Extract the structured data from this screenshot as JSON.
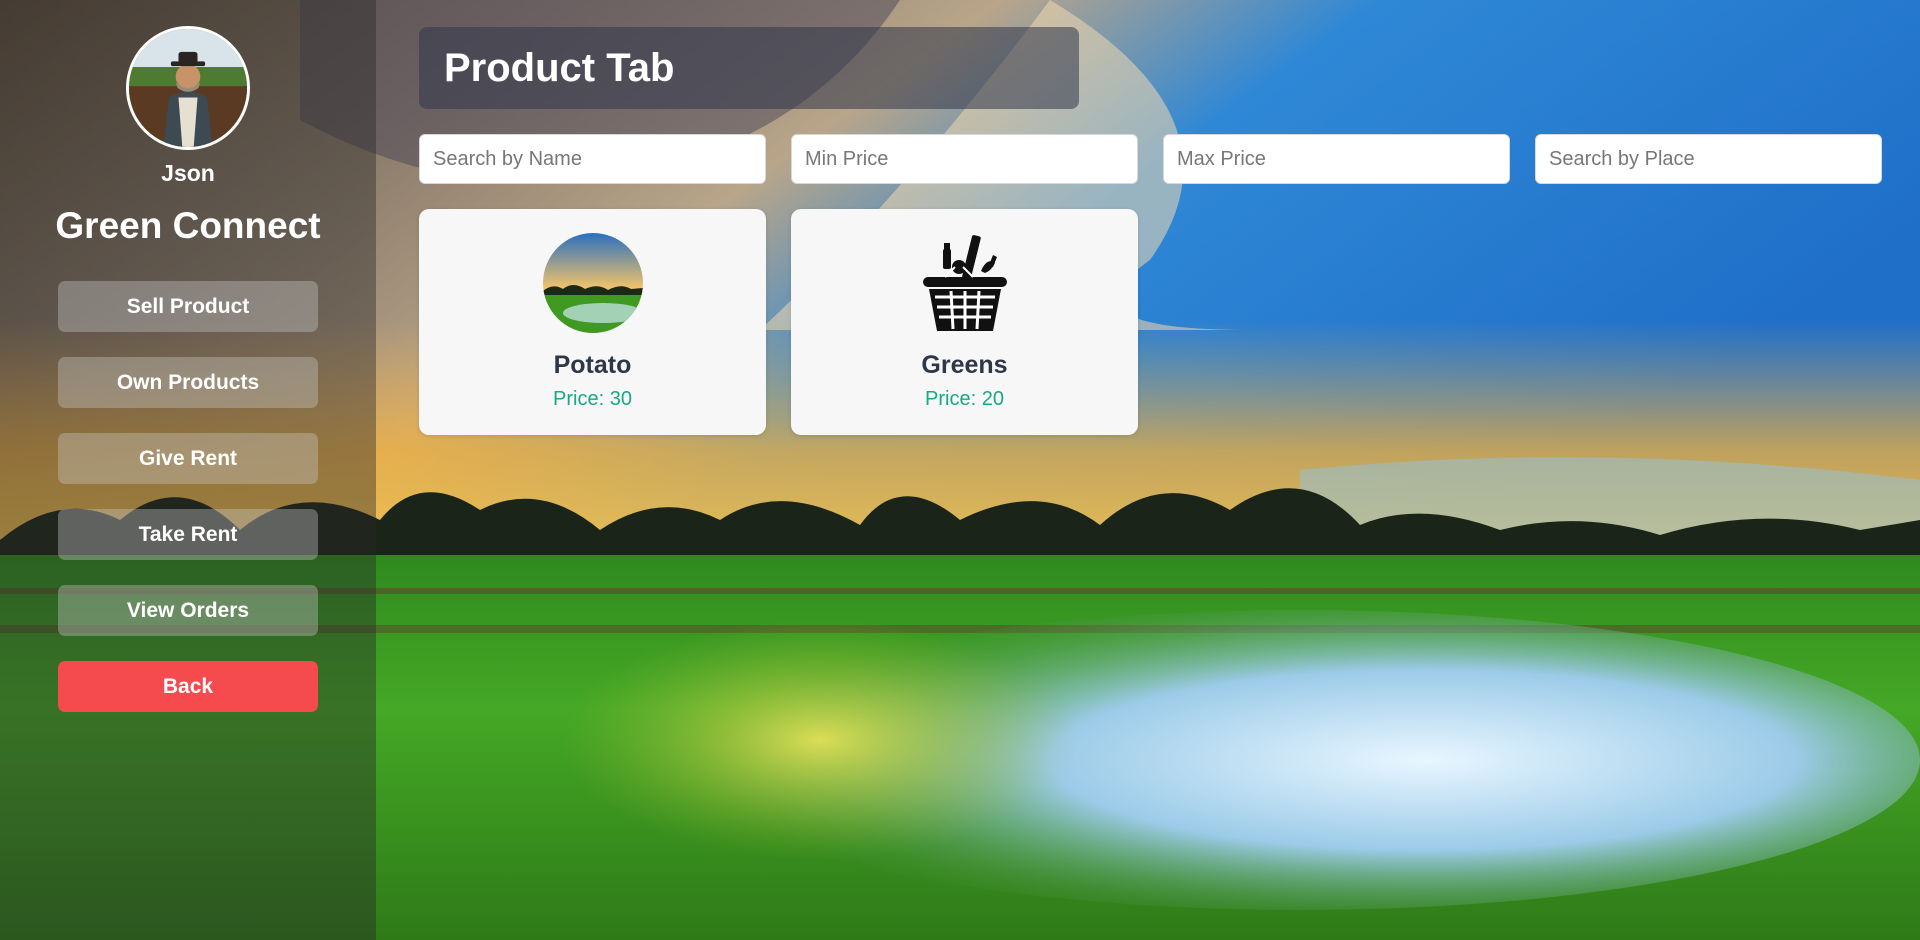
{
  "user": {
    "name": "Json"
  },
  "app": {
    "name": "Green Connect"
  },
  "nav": {
    "items": [
      {
        "label": "Sell Product"
      },
      {
        "label": "Own Products"
      },
      {
        "label": "Give Rent"
      },
      {
        "label": "Take Rent"
      },
      {
        "label": "View Orders"
      }
    ],
    "back_label": "Back"
  },
  "header": {
    "title": "Product Tab"
  },
  "filters": {
    "name_placeholder": "Search by Name",
    "min_price_placeholder": "Min Price",
    "max_price_placeholder": "Max Price",
    "place_placeholder": "Search by Place"
  },
  "products": [
    {
      "name": "Potato",
      "price": "Price: 30",
      "image": "field-sunset-photo"
    },
    {
      "name": "Greens",
      "price": "Price: 20",
      "image": "grocery-basket-icon"
    }
  ],
  "colors": {
    "back_button": "#f54b4f",
    "price_text": "#1aa882",
    "card_bg": "#f7f7f7"
  }
}
